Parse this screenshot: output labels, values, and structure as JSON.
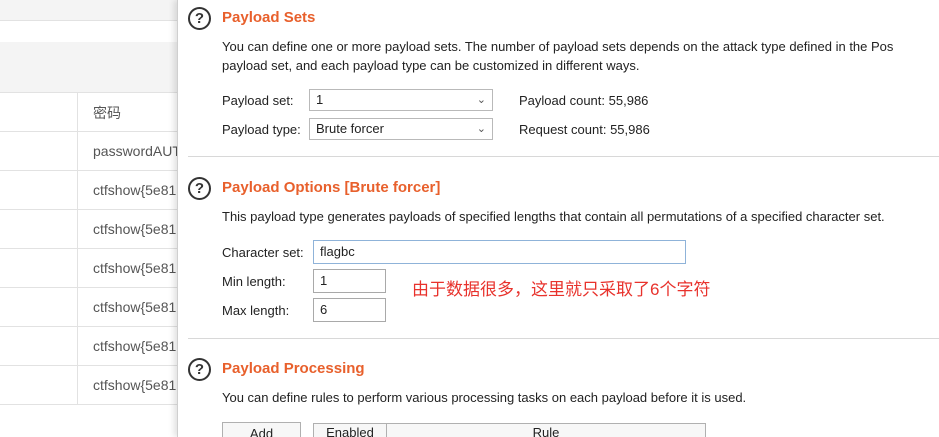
{
  "background_table": {
    "header": "密码",
    "rows": [
      "passwordAUT",
      "ctfshow{5e81",
      "ctfshow{5e81",
      "ctfshow{5e81",
      "ctfshow{5e81",
      "ctfshow{5e81",
      "ctfshow{5e81"
    ]
  },
  "payload_sets": {
    "help": "?",
    "title": "Payload Sets",
    "description_line1": "You can define one or more payload sets. The number of payload sets depends on the attack type defined in the Pos",
    "description_line2": "payload set, and each payload type can be customized in different ways.",
    "set_label": "Payload set:",
    "set_value": "1",
    "type_label": "Payload type:",
    "type_value": "Brute forcer",
    "count_label": "Payload count:",
    "count_value": "55,986",
    "request_label": "Request count:",
    "request_value": "55,986"
  },
  "payload_options": {
    "help": "?",
    "title": "Payload Options [Brute forcer]",
    "description": "This payload type generates payloads of specified lengths that contain all permutations of a specified character set.",
    "charset_label": "Character set:",
    "charset_value": "flagbc",
    "min_label": "Min length:",
    "min_value": "1",
    "max_label": "Max length:",
    "max_value": "6",
    "annotation": "由于数据很多，这里就只采取了6个字符"
  },
  "payload_processing": {
    "help": "?",
    "title": "Payload Processing",
    "description": "You can define rules to perform various processing tasks on each payload before it is used.",
    "add_button": "Add",
    "col_enabled": "Enabled",
    "col_rule": "Rule"
  },
  "icons": {
    "chevron": "chevron-down-icon",
    "help": "help-icon"
  },
  "colors": {
    "section_title": "#e8602c",
    "annotation": "#e8322c"
  }
}
